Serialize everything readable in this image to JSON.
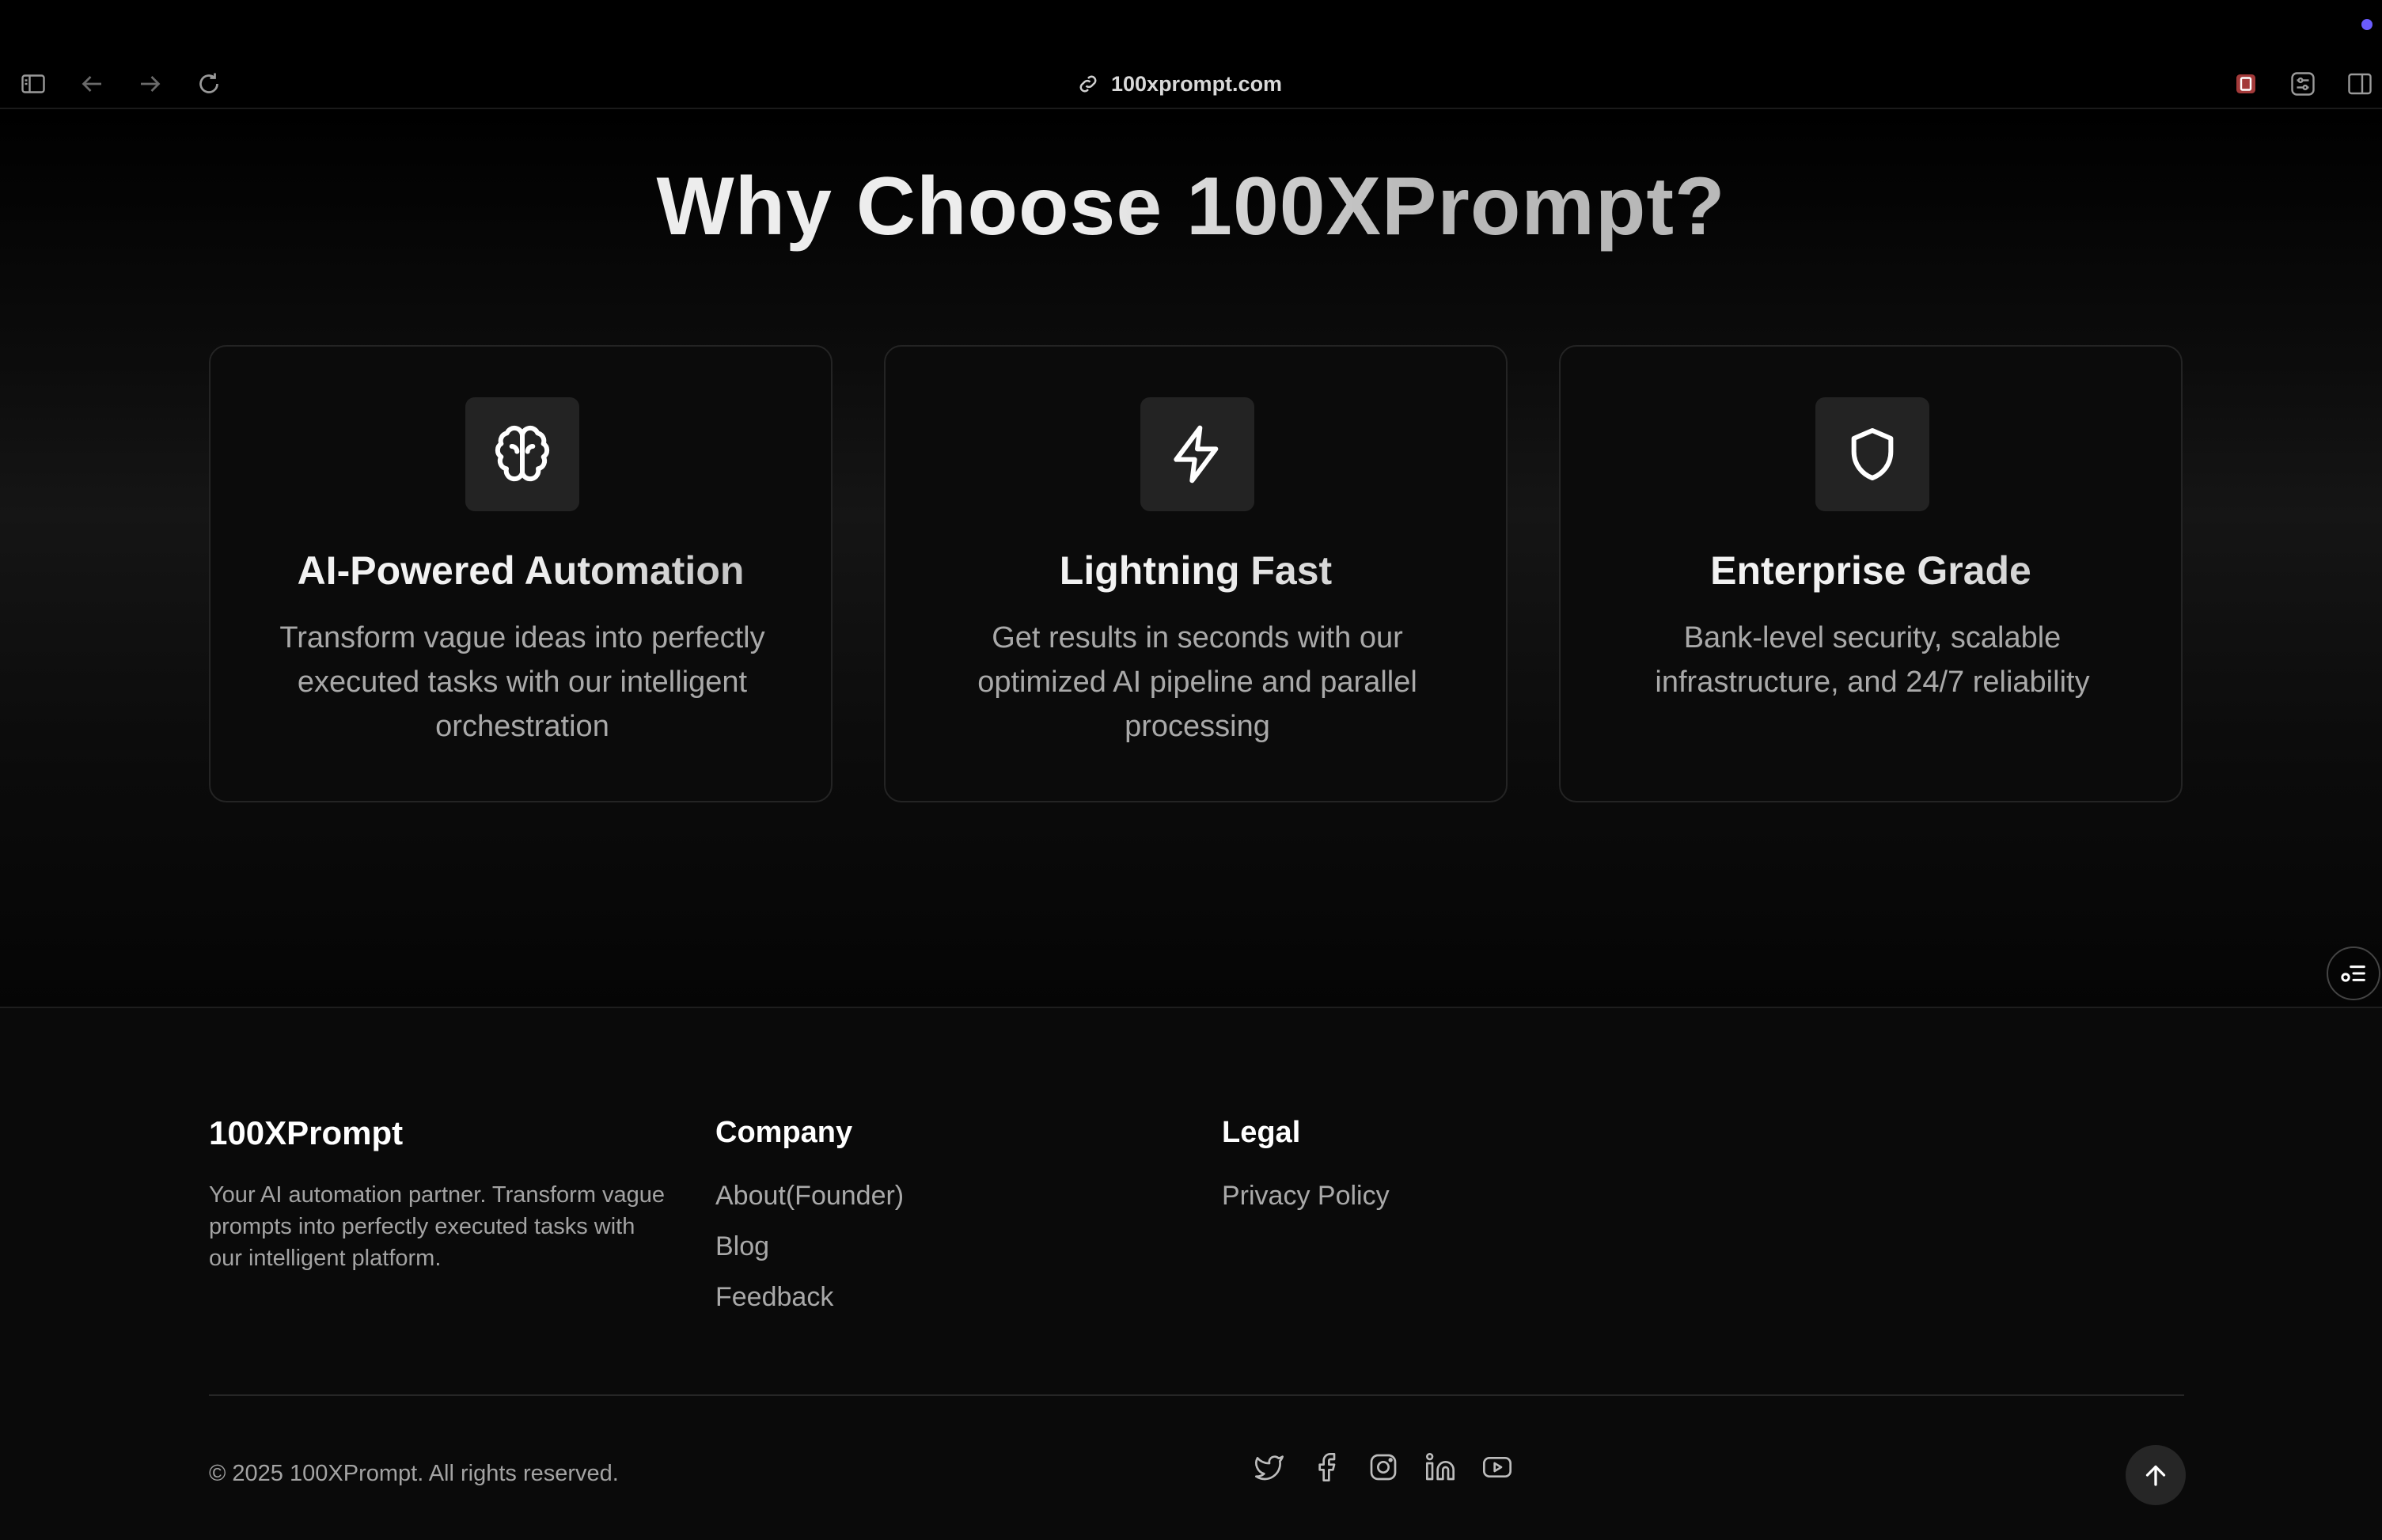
{
  "browser": {
    "url": "100xprompt.com",
    "buttons": [
      "sidebar-toggle-icon",
      "back-arrow-icon",
      "forward-arrow-icon",
      "reload-icon",
      "extension-icon",
      "tune-icon",
      "split-view-icon"
    ]
  },
  "features": {
    "title": "Why Choose 100XPrompt?",
    "cards": [
      {
        "icon": "brain-icon",
        "title": "AI-Powered Automation",
        "description": "Transform vague ideas into perfectly executed tasks with our intelligent orchestration"
      },
      {
        "icon": "lightning-icon",
        "title": "Lightning Fast",
        "description": "Get results in seconds with our optimized AI pipeline and parallel processing"
      },
      {
        "icon": "shield-icon",
        "title": "Enterprise Grade",
        "description": "Bank-level security, scalable infrastructure, and 24/7 reliability"
      }
    ]
  },
  "footer": {
    "brand": {
      "name": "100XPrompt",
      "tagline": "Your AI automation partner. Transform vague prompts into perfectly executed tasks with our intelligent platform."
    },
    "company": {
      "title": "Company",
      "links": [
        "About(Founder)",
        "Blog",
        "Feedback"
      ]
    },
    "legal": {
      "title": "Legal",
      "links": [
        "Privacy Policy"
      ]
    },
    "copyright": "© 2025 100XPrompt. All rights reserved.",
    "socials": [
      "twitter-icon",
      "facebook-icon",
      "instagram-icon",
      "linkedin-icon",
      "youtube-icon"
    ]
  },
  "colors": {
    "background": "#000000",
    "card_bg": "#0b0b0b",
    "icon_box": "#232323",
    "accent_dot": "#6b5cff"
  }
}
